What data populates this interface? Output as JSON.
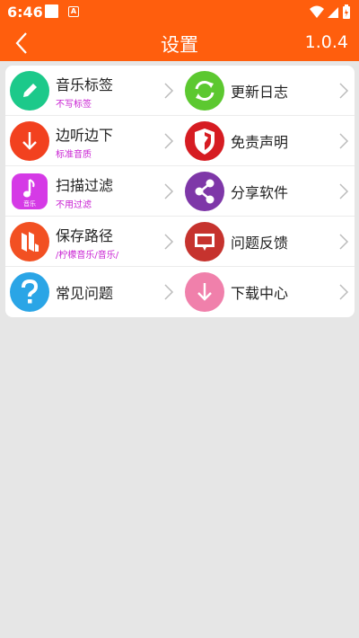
{
  "status_bar": {
    "time": "6:46"
  },
  "header": {
    "title": "设置",
    "version": "1.0.4"
  },
  "settings": [
    {
      "label": "音乐标签",
      "sub": "不写标签",
      "icon": "pencil-icon",
      "color": "#1cc98a"
    },
    {
      "label": "更新日志",
      "sub": "",
      "icon": "refresh-icon",
      "color": "#5cc830"
    },
    {
      "label": "边听边下",
      "sub": "标准音质",
      "icon": "download-arrow-icon",
      "color": "#f2411f"
    },
    {
      "label": "免责声明",
      "sub": "",
      "icon": "shield-icon",
      "color": "#d61c22"
    },
    {
      "label": "扫描过滤",
      "sub": "不用过滤",
      "icon": "music-note-icon",
      "color": "#d53ae6"
    },
    {
      "label": "分享软件",
      "sub": "",
      "icon": "share-icon",
      "color": "#7e37a8"
    },
    {
      "label": "保存路径",
      "sub": "/柠檬音乐/音乐/",
      "icon": "folder-logo-icon",
      "color": "#f25022"
    },
    {
      "label": "问题反馈",
      "sub": "",
      "icon": "feedback-icon",
      "color": "#c6332e"
    },
    {
      "label": "常见问题",
      "sub": "",
      "icon": "question-icon",
      "color": "#2aa5e6"
    },
    {
      "label": "下载中心",
      "sub": "",
      "icon": "download-center-icon",
      "color": "#f080ab"
    }
  ],
  "icon_text": {
    "music_tile": "音乐"
  },
  "colors": {
    "primary": "#ff5e0d",
    "accent_subtext": "#c81fd2",
    "background": "#e6e6e6"
  }
}
